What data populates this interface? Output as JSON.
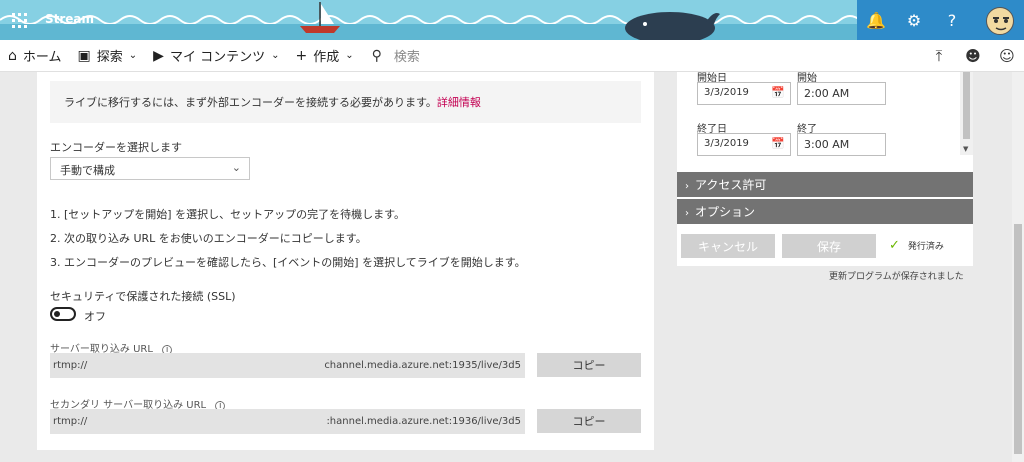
{
  "app": {
    "brand": "Stream"
  },
  "nav": {
    "home": "ホーム",
    "explore": "探索",
    "my_content": "マイ コンテンツ",
    "create": "作成",
    "search_placeholder": "検索"
  },
  "icons": {
    "waffle": "waffle-icon",
    "bell": "bell-icon",
    "gear": "gear-icon",
    "help": "help-icon",
    "upload": "upload-icon",
    "person": "person-icon",
    "smiley": "smiley-icon"
  },
  "left": {
    "info_text": "ライブに移行するには、まず外部エンコーダーを接続する必要があります。",
    "info_link": "詳細情報",
    "encoder_label": "エンコーダーを選択します",
    "encoder_value": "手動で構成",
    "steps": [
      "1. [セットアップを開始] を選択し、セットアップの完了を待機します。",
      "2. 次の取り込み URL をお使いのエンコーダーにコピーします。",
      "3. エンコーダーのプレビューを確認したら、[イベントの開始] を選択してライブを開始します。"
    ],
    "ssl_label": "セキュリティで保護された接続 (SSL)",
    "ssl_state": "オフ",
    "ingest_label": "サーバー取り込み URL",
    "ingest_prefix": "rtmp://",
    "ingest_value": "channel.media.azure.net:1935/live/3d5",
    "secondary_label": "セカンダリ サーバー取り込み URL",
    "secondary_prefix": "rtmp://",
    "secondary_value": ":hannel.media.azure.net:1936/live/3d5",
    "copy_label": "コピー"
  },
  "right": {
    "start_date_label": "開始日",
    "start_time_label": "開始",
    "start_date": "3/3/2019",
    "start_time": "2:00 AM",
    "end_date_label": "終了日",
    "end_time_label": "終了",
    "end_date": "3/3/2019",
    "end_time": "3:00 AM",
    "access_label": "アクセス許可",
    "options_label": "オプション",
    "cancel_label": "キャンセル",
    "save_label": "保存",
    "published_label": "発行済み",
    "saved_message": "更新プログラムが保存されました"
  },
  "colors": {
    "banner": "#7fcbe0",
    "header_right": "#2e8bc9",
    "link": "#c30052",
    "section_bar": "#737373",
    "check": "#6bb700"
  }
}
